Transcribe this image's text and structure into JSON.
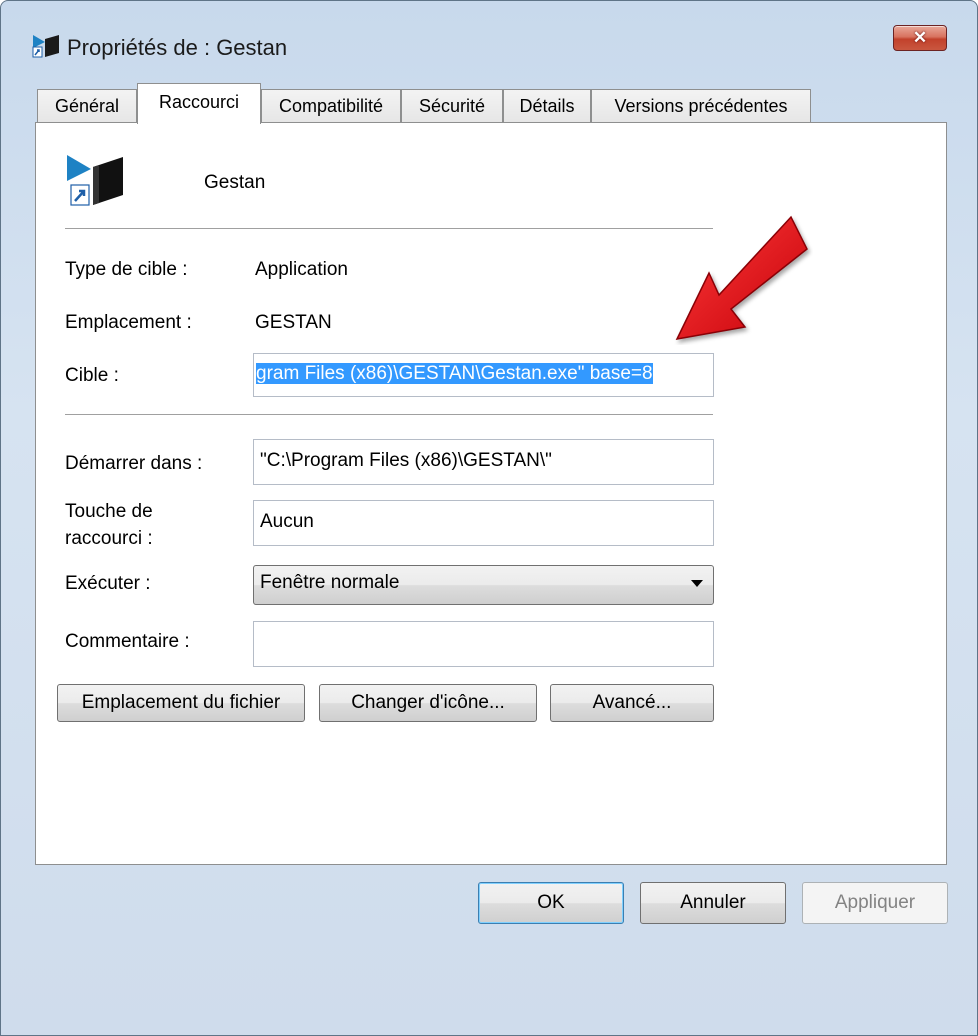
{
  "window": {
    "title": "Propriétés de : Gestan",
    "close_glyph": "✕"
  },
  "tabs": [
    {
      "label": "Général",
      "active": false
    },
    {
      "label": "Raccourci",
      "active": true
    },
    {
      "label": "Compatibilité",
      "active": false
    },
    {
      "label": "Sécurité",
      "active": false
    },
    {
      "label": "Détails",
      "active": false
    },
    {
      "label": "Versions précédentes",
      "active": false
    }
  ],
  "shortcut": {
    "name": "Gestan",
    "icon": "gestan-shortcut-icon"
  },
  "fields": {
    "target_type_label": "Type de cible :",
    "target_type_value": "Application",
    "location_label": "Emplacement :",
    "location_value": "GESTAN",
    "target_label": "Cible :",
    "target_value": "gram Files (x86)\\GESTAN\\Gestan.exe\" base=8",
    "start_in_label": "Démarrer dans :",
    "start_in_value": "\"C:\\Program Files (x86)\\GESTAN\\\"",
    "hotkey_label_line1": "Touche de",
    "hotkey_label_line2": "raccourci :",
    "hotkey_value": "Aucun",
    "run_label": "Exécuter :",
    "run_value": "Fenêtre normale",
    "comment_label": "Commentaire :",
    "comment_value": ""
  },
  "buttons": {
    "open_location": "Emplacement du fichier",
    "change_icon": "Changer d'icône...",
    "advanced": "Avancé...",
    "ok": "OK",
    "cancel": "Annuler",
    "apply": "Appliquer"
  },
  "colors": {
    "selection": "#3399ff",
    "annotation_arrow": "#e8141c"
  }
}
